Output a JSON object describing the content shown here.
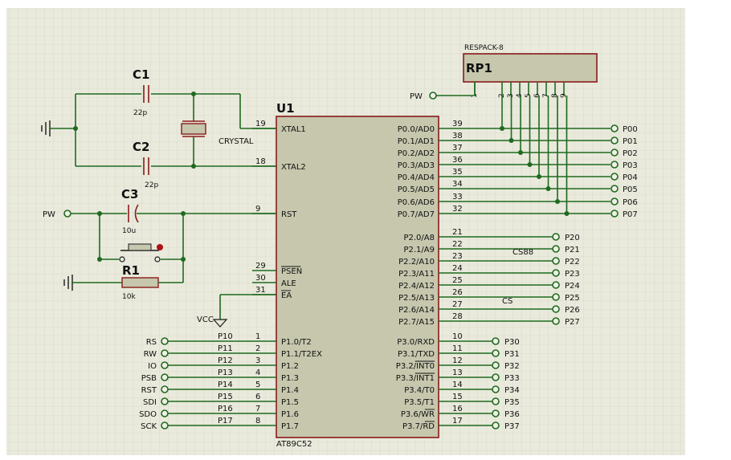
{
  "chip": {
    "designator": "U1",
    "part": "AT89C52",
    "pins_left": [
      {
        "num": "19",
        "name": "XTAL1"
      },
      {
        "num": "18",
        "name": "XTAL2"
      },
      {
        "num": "9",
        "name": "RST"
      },
      {
        "num": "29",
        "name": "PSEN"
      },
      {
        "num": "30",
        "name": "ALE"
      },
      {
        "num": "31",
        "name": "EA"
      },
      {
        "num": "1",
        "name": "P1.0/T2"
      },
      {
        "num": "2",
        "name": "P1.1/T2EX"
      },
      {
        "num": "3",
        "name": "P1.2"
      },
      {
        "num": "4",
        "name": "P1.3"
      },
      {
        "num": "5",
        "name": "P1.4"
      },
      {
        "num": "6",
        "name": "P1.5"
      },
      {
        "num": "7",
        "name": "P1.6"
      },
      {
        "num": "8",
        "name": "P1.7"
      }
    ],
    "pins_right": [
      {
        "num": "39",
        "name": "P0.0/AD0"
      },
      {
        "num": "38",
        "name": "P0.1/AD1"
      },
      {
        "num": "37",
        "name": "P0.2/AD2"
      },
      {
        "num": "36",
        "name": "P0.3/AD3"
      },
      {
        "num": "35",
        "name": "P0.4/AD4"
      },
      {
        "num": "34",
        "name": "P0.5/AD5"
      },
      {
        "num": "33",
        "name": "P0.6/AD6"
      },
      {
        "num": "32",
        "name": "P0.7/AD7"
      },
      {
        "num": "21",
        "name": "P2.0/A8"
      },
      {
        "num": "22",
        "name": "P2.1/A9"
      },
      {
        "num": "23",
        "name": "P2.2/A10"
      },
      {
        "num": "24",
        "name": "P2.3/A11"
      },
      {
        "num": "25",
        "name": "P2.4/A12"
      },
      {
        "num": "26",
        "name": "P2.5/A13"
      },
      {
        "num": "27",
        "name": "P2.6/A14"
      },
      {
        "num": "28",
        "name": "P2.7/A15"
      },
      {
        "num": "10",
        "name": "P3.0/RXD"
      },
      {
        "num": "11",
        "name": "P3.1/TXD"
      },
      {
        "num": "12",
        "name": "P3.2/INT0"
      },
      {
        "num": "13",
        "name": "P3.3/INT1"
      },
      {
        "num": "14",
        "name": "P3.4/T0"
      },
      {
        "num": "15",
        "name": "P3.5/T1"
      },
      {
        "num": "16",
        "name": "P3.6/WR"
      },
      {
        "num": "17",
        "name": "P3.7/RD"
      }
    ]
  },
  "terminals": {
    "port0": [
      "P00",
      "P01",
      "P02",
      "P03",
      "P04",
      "P05",
      "P06",
      "P07"
    ],
    "port2": [
      "P20",
      "P21",
      "P22",
      "P23",
      "P24",
      "P25",
      "P26",
      "P27"
    ],
    "port3": [
      "P30",
      "P31",
      "P32",
      "P33",
      "P34",
      "P35",
      "P36",
      "P37"
    ],
    "port1_left": [
      "RS",
      "RW",
      "IO",
      "PSB",
      "RST",
      "SDI",
      "SDO",
      "SCK"
    ],
    "port1_nets": [
      "P10",
      "P11",
      "P12",
      "P13",
      "P14",
      "P15",
      "P16",
      "P17"
    ],
    "pw_rst": "PW",
    "pw_rp": "PW"
  },
  "net_labels": {
    "cs88": "CS88",
    "cs": "CS",
    "vcc": "VCC"
  },
  "components": {
    "c1": {
      "name": "C1",
      "value": "22p"
    },
    "c2": {
      "name": "C2",
      "value": "22p"
    },
    "c3": {
      "name": "C3",
      "value": "10u"
    },
    "r1": {
      "name": "R1",
      "value": "10k"
    },
    "crystal": {
      "value": "CRYSTAL"
    },
    "respack": {
      "type": "RESPACK-8",
      "name": "RP1",
      "pins": [
        "1",
        "2",
        "3",
        "4",
        "5",
        "6",
        "7",
        "8",
        "9"
      ]
    }
  },
  "colors": {
    "grid_bg": "#e9eadc",
    "grid_line": "#cfd1bf",
    "chip_fill": "#c6c7ad",
    "wire": "#1f6a1f",
    "component": "#8b1a1a"
  }
}
